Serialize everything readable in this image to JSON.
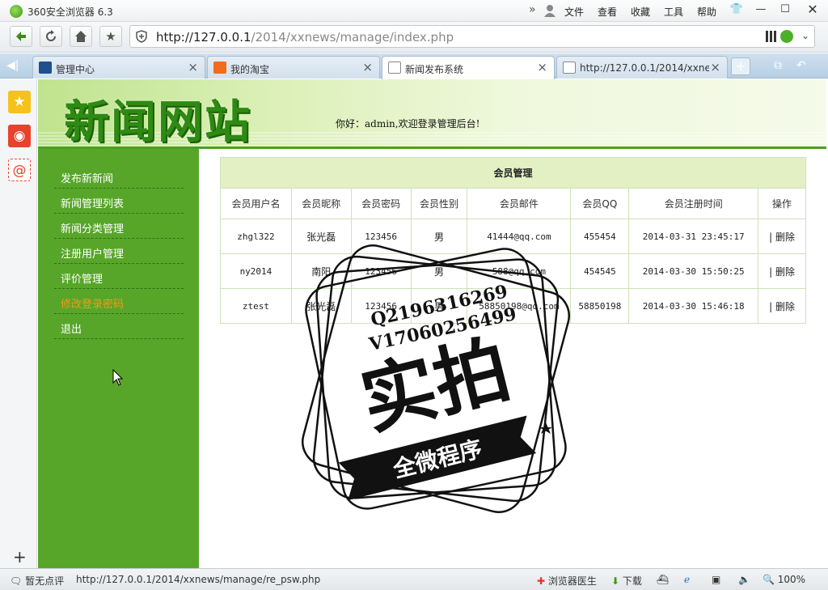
{
  "browser": {
    "title": "360安全浏览器 6.3",
    "menu": [
      "文件",
      "查看",
      "收藏",
      "工具",
      "帮助"
    ],
    "url_host": "http://127.0.0.1",
    "url_path": "/2014/xxnews/manage/index.php",
    "tabs": [
      {
        "label": "管理中心",
        "icon": "cms-icon"
      },
      {
        "label": "我的淘宝",
        "icon": "taobao-icon"
      },
      {
        "label": "新闻发布系统",
        "icon": "page-icon"
      },
      {
        "label": "http://127.0.0.1/2014/xxnew",
        "icon": "page-icon"
      }
    ],
    "status": {
      "comment": "暂无点评",
      "link": "http://127.0.0.1/2014/xxnews/manage/re_psw.php",
      "doctor": "浏览器医生",
      "download": "下载",
      "zoom": "100%"
    }
  },
  "site": {
    "logo": "新闻网站",
    "welcome": "你好：admin,欢迎登录管理后台!",
    "nav": [
      "发布新新闻",
      "新闻管理列表",
      "新闻分类管理",
      "注册用户管理",
      "评价管理",
      "修改登录密码",
      "退出"
    ],
    "nav_hover_color": "#f39a1c"
  },
  "members": {
    "caption": "会员管理",
    "columns": [
      "会员用户名",
      "会员昵称",
      "会员密码",
      "会员性别",
      "会员邮件",
      "会员QQ",
      "会员注册时间",
      "操作"
    ],
    "rows": [
      [
        "zhgl322",
        "张光磊",
        "123456",
        "男",
        "41444@qq.com",
        "455454",
        "2014-03-31 23:45:17",
        "| 删除"
      ],
      [
        "ny2014",
        "南阳",
        "123456",
        "男",
        "588@qq.com",
        "454545",
        "2014-03-30 15:50:25",
        "| 删除"
      ],
      [
        "ztest",
        "张光磊",
        "123456",
        "男",
        "58850198@qq.com",
        "58850198",
        "2014-03-30 15:46:18",
        "| 删除"
      ]
    ]
  },
  "watermark": {
    "qq": "Q2196316269",
    "v": "V17060256499",
    "main": "实拍",
    "banner": "全微程序"
  }
}
